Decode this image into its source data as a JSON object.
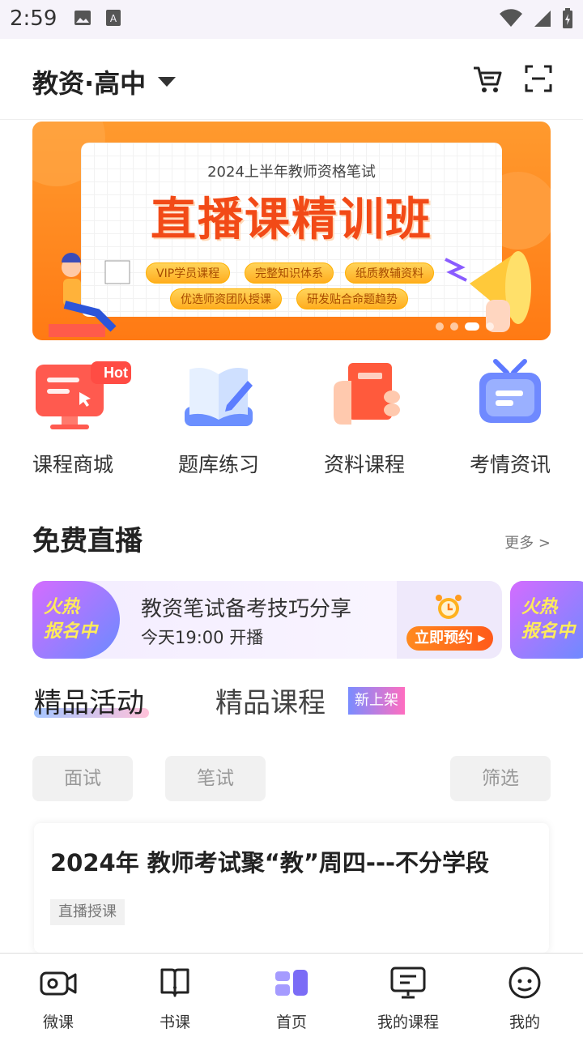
{
  "status_bar": {
    "time": "2:59"
  },
  "appbar": {
    "title": "教资·高中"
  },
  "banner": {
    "subtitle": "2024上半年教师资格笔试",
    "headline": "直播课精训班",
    "tags": [
      "VIP学员课程",
      "完整知识体系",
      "纸质教辅资料",
      "优选师资团队授课",
      "研发贴合命题趋势"
    ]
  },
  "quick_links": [
    {
      "label": "课程商城",
      "badge": "Hot",
      "icon": "screen-icon"
    },
    {
      "label": "题库练习",
      "icon": "book-pen-icon"
    },
    {
      "label": "资料课程",
      "icon": "hand-book-icon"
    },
    {
      "label": "考情资讯",
      "icon": "tv-icon"
    }
  ],
  "free_live": {
    "title": "免费直播",
    "more": "更多 >",
    "card": {
      "hot_line1": "火热",
      "hot_line2": "报名中",
      "title": "教资笔试备考技巧分享",
      "time": "今天19:00 开播",
      "button": "立即预约"
    },
    "card2": {
      "hot_line1": "火热",
      "hot_line2": "报名中"
    }
  },
  "tabs": {
    "active": "精品活动",
    "other": "精品课程",
    "new_badge": "新上架"
  },
  "filters": {
    "interview": "面试",
    "written": "笔试",
    "filter": "筛选"
  },
  "course": {
    "title": "2024年 教师考试聚“教”周四---不分学段",
    "tag": "直播授课"
  },
  "bottom_nav": [
    {
      "label": "微课",
      "icon": "video-camera-icon"
    },
    {
      "label": "书课",
      "icon": "book-icon"
    },
    {
      "label": "首页",
      "icon": "home-grid-icon",
      "active": true
    },
    {
      "label": "我的课程",
      "icon": "monitor-icon"
    },
    {
      "label": "我的",
      "icon": "smiley-icon"
    }
  ],
  "colors": {
    "accent": "#7b6cf6",
    "orange": "#ff7a14",
    "text": "#222222"
  }
}
